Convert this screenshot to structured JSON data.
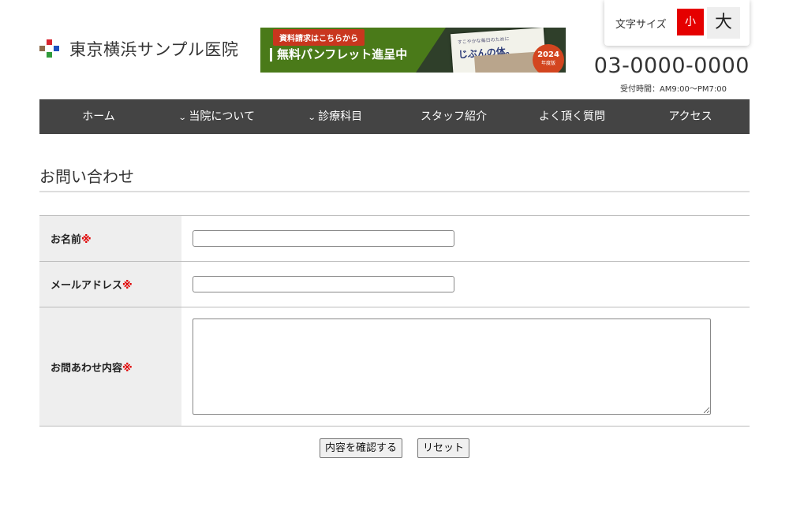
{
  "header": {
    "site_name": "東京横浜サンプル医院",
    "banner": {
      "tag": "資料請求はこちらから",
      "main": "無料パンフレット進呈中",
      "book_small": "すこやかな毎日のために",
      "book_title": "じぶんの体。",
      "badge_year": "2024",
      "badge_sub": "年度版"
    },
    "font_size": {
      "label": "文字サイズ",
      "small": "小",
      "large": "大"
    },
    "phone": "03-0000-0000",
    "hours": "受付時間：AM9:00〜PM7:00"
  },
  "nav": {
    "items": [
      {
        "label": "ホーム",
        "chevron": ""
      },
      {
        "label": "当院について",
        "chevron": "⌄"
      },
      {
        "label": "診療科目",
        "chevron": "⌄"
      },
      {
        "label": "スタッフ紹介",
        "chevron": ""
      },
      {
        "label": "よく頂く質問",
        "chevron": ""
      },
      {
        "label": "アクセス",
        "chevron": ""
      }
    ]
  },
  "page": {
    "title": "お問い合わせ"
  },
  "form": {
    "required_mark": "※",
    "fields": [
      {
        "label": "お名前",
        "value": "",
        "placeholder": ""
      },
      {
        "label": "メールアドレス",
        "value": "",
        "placeholder": ""
      },
      {
        "label": "お問あわせ内容",
        "value": "",
        "placeholder": ""
      }
    ],
    "confirm_label": "内容を確認する",
    "reset_label": "リセット"
  },
  "colors": {
    "nav_bg": "#444444",
    "accent_red": "#e50000",
    "banner_green": "#4a7a19"
  }
}
